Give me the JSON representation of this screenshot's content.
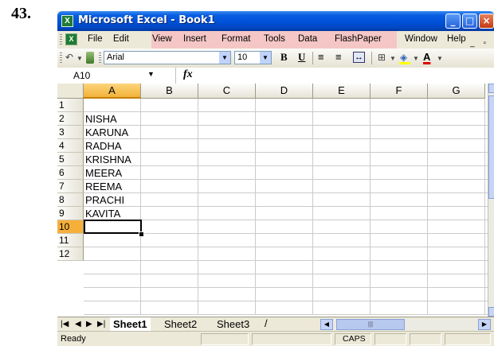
{
  "question_number": "43.",
  "window": {
    "title": "Microsoft Excel - Book1",
    "controls": {
      "minimize": "_",
      "maximize": "□",
      "close": "×"
    }
  },
  "menu": {
    "items": [
      {
        "label": "File",
        "name": "menu-file"
      },
      {
        "label": "Edit",
        "name": "menu-edit"
      },
      {
        "label": "View",
        "name": "menu-view"
      },
      {
        "label": "Insert",
        "name": "menu-insert"
      },
      {
        "label": "Format",
        "name": "menu-format"
      },
      {
        "label": "Tools",
        "name": "menu-tools"
      },
      {
        "label": "Data",
        "name": "menu-data"
      },
      {
        "label": "FlashPaper",
        "name": "menu-flashpaper"
      },
      {
        "label": "Window",
        "name": "menu-window"
      },
      {
        "label": "Help",
        "name": "menu-help"
      }
    ],
    "highlight_color": "#f4c6c6",
    "doc_controls": "_ ▫"
  },
  "toolbar": {
    "font": "Arial",
    "size": "10",
    "bold": "B",
    "underline": "U"
  },
  "formula_bar": {
    "name_box": "A10",
    "fx": "fx",
    "value": ""
  },
  "grid": {
    "columns": [
      "A",
      "B",
      "C",
      "D",
      "E",
      "F",
      "G"
    ],
    "active_column": "A",
    "rows": [
      "1",
      "2",
      "3",
      "4",
      "5",
      "6",
      "7",
      "8",
      "9",
      "10",
      "11",
      "12"
    ],
    "active_row": "10",
    "cells_A": [
      "",
      "NISHA",
      "KARUNA",
      "RADHA",
      "KRISHNA",
      "MEERA",
      "REEMA",
      "PRACHI",
      "KAVITA",
      "",
      "",
      ""
    ]
  },
  "sheets": {
    "tabs": [
      "Sheet1",
      "Sheet2",
      "Sheet3"
    ],
    "active": "Sheet1"
  },
  "status": {
    "text": "Ready",
    "caps": "CAPS"
  },
  "colors": {
    "title_bar": "#0050d8",
    "active_header": "#f6b03a",
    "window_bg": "#ece9d8"
  }
}
